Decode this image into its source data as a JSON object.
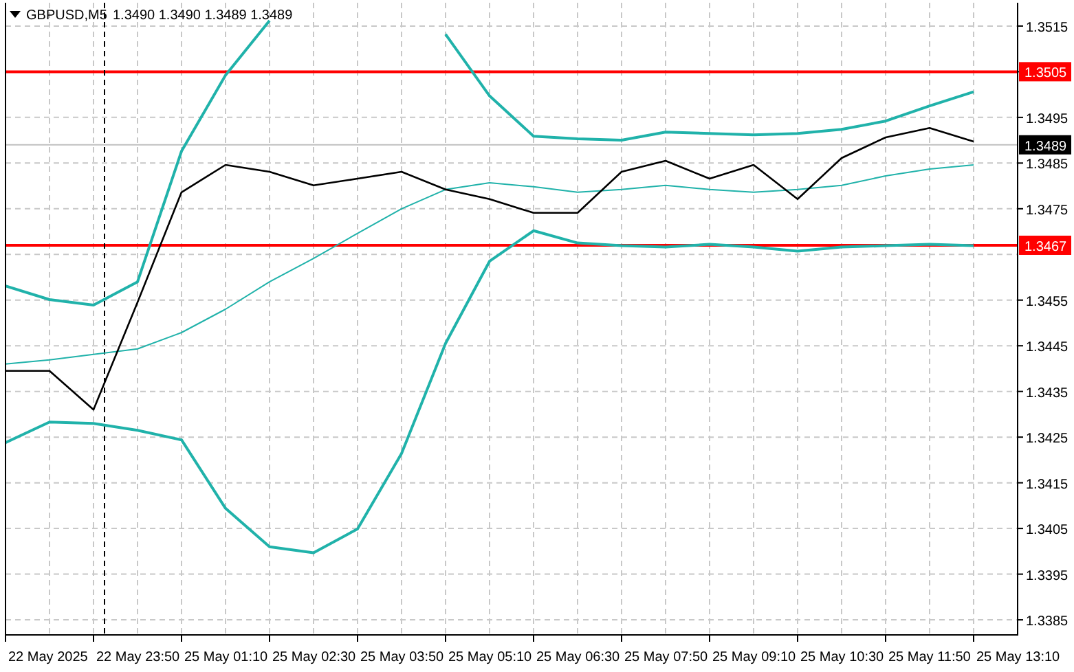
{
  "header": {
    "symbol": "GBPUSD,M5",
    "quotes": [
      "1.3490",
      "1.3490",
      "1.3489",
      "1.3489"
    ]
  },
  "chart": {
    "chart_data": {
      "type": "line",
      "grid": true,
      "ylim": [
        1.33817,
        1.35201
      ],
      "categories": [
        null,
        "22 May 2025",
        null,
        "22 May 23:50",
        null,
        "25 May 01:10",
        null,
        "25 May 02:30",
        null,
        "25 May 03:50",
        null,
        "25 May 05:10",
        null,
        "25 May 06:30",
        null,
        "25 May 07:50",
        null,
        "25 May 09:10",
        null,
        "25 May 10:30",
        null,
        "25 May 11:50",
        null,
        "25 May 13:10"
      ],
      "yticks": [
        1.3515,
        1.3505,
        1.3495,
        1.3485,
        1.3475,
        1.3455,
        1.3445,
        1.3435,
        1.3425,
        1.3415,
        1.3405,
        1.3395,
        1.3385
      ],
      "series": [
        {
          "color": "#20b2aa",
          "values": [
            1.34581,
            1.34551,
            1.34539,
            1.3459,
            1.34876,
            1.35042,
            1.35162,
            null,
            null,
            null,
            1.35132,
            1.34997,
            1.34909,
            1.34903,
            1.349,
            1.34918,
            1.34915,
            1.34912,
            1.34915,
            1.34924,
            1.34942,
            1.34975,
            1.35006,
            null
          ]
        },
        {
          "color": "#20b2aa",
          "values": [
            1.3441,
            1.34419,
            1.34431,
            1.34443,
            1.34479,
            1.3453,
            1.3459,
            1.34641,
            1.34696,
            1.3475,
            1.34792,
            1.34807,
            1.34798,
            1.34786,
            1.34792,
            1.34801,
            1.34792,
            1.34786,
            1.34792,
            1.34801,
            1.34822,
            1.34837,
            1.34846,
            null
          ]
        },
        {
          "color": "#20b2aa",
          "values": [
            1.34238,
            1.34283,
            1.3428,
            1.34265,
            1.34244,
            1.34094,
            1.3401,
            1.33997,
            1.34049,
            1.34214,
            1.34455,
            1.34635,
            1.34702,
            1.34675,
            1.34669,
            1.34666,
            1.34672,
            1.34666,
            1.34657,
            1.34666,
            1.34669,
            1.34672,
            1.34669,
            null
          ]
        },
        {
          "color": "#000000",
          "values": [
            1.34395,
            1.34395,
            1.3431,
            1.34545,
            1.34786,
            1.34846,
            1.34831,
            1.34801,
            1.34816,
            1.34831,
            1.34792,
            1.34771,
            1.34741,
            1.34741,
            1.34831,
            1.34855,
            1.34816,
            1.34846,
            1.34771,
            1.34861,
            1.34906,
            1.34927,
            1.34897,
            null
          ]
        }
      ],
      "ref_lines": [
        {
          "axis": "y",
          "value": 1.3505,
          "label": "1.3505",
          "color": "#ff0000"
        },
        {
          "axis": "y",
          "value": 1.3467,
          "label": "1.3467",
          "color": "#ff0000"
        },
        {
          "axis": "y",
          "value": 1.3489,
          "label": "1.3489",
          "color": "#c0c0c0"
        }
      ]
    }
  }
}
